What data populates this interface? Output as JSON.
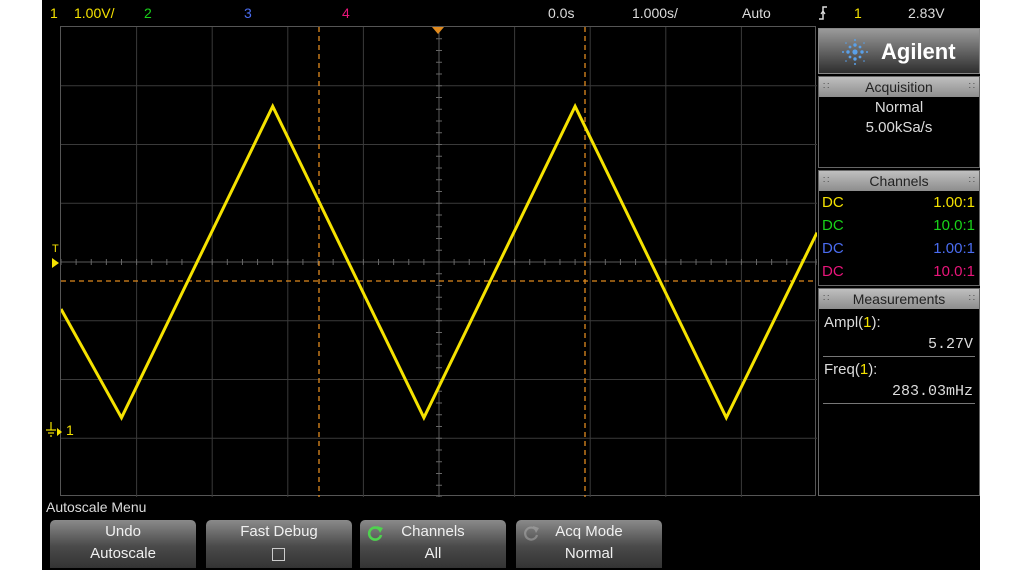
{
  "header": {
    "ch1_num": "1",
    "ch1_scale": "1.00V/",
    "ch2_num": "2",
    "ch3_num": "3",
    "ch4_num": "4",
    "time_delay": "0.0s",
    "time_scale": "1.000s/",
    "trigger_mode": "Auto",
    "trigger_icon": "rising-edge-icon",
    "trigger_source": "1",
    "trigger_level": "2.83V"
  },
  "markers": {
    "trigger_level_label": "T",
    "ground_label": "1"
  },
  "brand": {
    "name": "Agilent",
    "logo_icon": "agilent-spark-icon"
  },
  "acquisition": {
    "title": "Acquisition",
    "mode": "Normal",
    "rate": "5.00kSa/s"
  },
  "channels": {
    "title": "Channels",
    "rows": [
      {
        "coupling": "DC",
        "probe": "1.00:1",
        "color": "#f5e200"
      },
      {
        "coupling": "DC",
        "probe": "10.0:1",
        "color": "#19d219"
      },
      {
        "coupling": "DC",
        "probe": "1.00:1",
        "color": "#4a6cf0"
      },
      {
        "coupling": "DC",
        "probe": "10.0:1",
        "color": "#e8157a"
      }
    ]
  },
  "measurements": {
    "title": "Measurements",
    "ampl_label": "Ampl(",
    "ampl_ch": "1",
    "ampl_close": "):",
    "ampl_value": "5.27V",
    "freq_label": "Freq(",
    "freq_ch": "1",
    "freq_close": "):",
    "freq_value": "283.03mHz"
  },
  "softkeys": {
    "menu_title": "Autoscale Menu",
    "undo_line1": "Undo",
    "undo_line2": "Autoscale",
    "fastdebug_line1": "Fast Debug",
    "fastdebug_checked": false,
    "channels_icon": "cycle-arrow-icon",
    "channels_line1": "Channels",
    "channels_line2": "All",
    "acq_icon": "cycle-arrow-icon",
    "acq_line1": "Acq Mode",
    "acq_line2": "Normal"
  },
  "colors": {
    "ch1": "#f5e200",
    "ch2": "#19d219",
    "ch3": "#4a6cf0",
    "ch4": "#e8157a",
    "cursor": "#e08a1e"
  },
  "chart_data": {
    "type": "line",
    "series": [
      {
        "x": [
          -5,
          -4.2,
          -2.2,
          -0.2,
          1.8,
          3.8,
          5
        ],
        "y": [
          -0.8,
          -2.65,
          2.65,
          -2.65,
          2.65,
          -2.65,
          0.5
        ]
      }
    ],
    "xlim": [
      -5,
      5
    ],
    "ylim": [
      -4,
      4
    ],
    "grid": true
  }
}
